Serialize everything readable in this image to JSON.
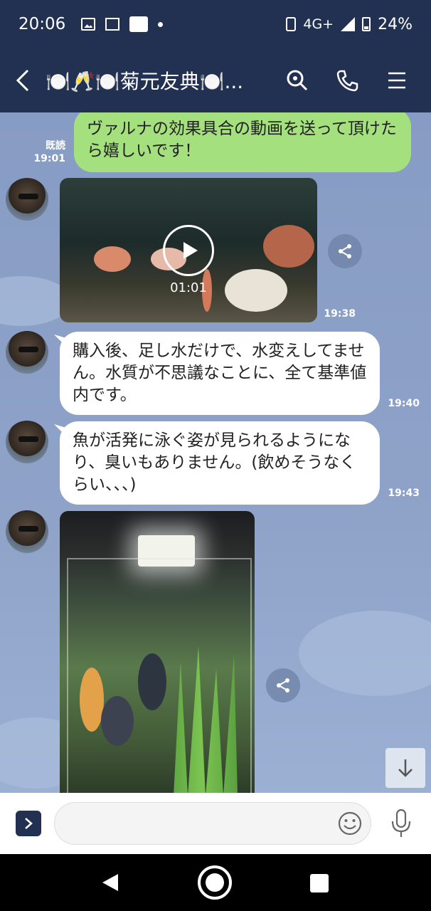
{
  "status_bar": {
    "time": "20:06",
    "network": "4G+",
    "battery": "24%",
    "icons": [
      "image-icon",
      "mail-icon",
      "app-brand-icon",
      "dot-icon",
      "vibrate-icon",
      "signal-icon",
      "battery-icon"
    ]
  },
  "header": {
    "title": "🍽️🥂🍽️菊元友典🍽️...",
    "icons": [
      "back-icon",
      "search-icon",
      "phone-icon",
      "menu-icon"
    ]
  },
  "messages": [
    {
      "type": "text",
      "direction": "outgoing",
      "text": "ヴァルナの効果具合の動画を送って頂けたら嬉しいです！",
      "read_label": "既読",
      "time": "19:01"
    },
    {
      "type": "video",
      "direction": "incoming",
      "duration": "01:01",
      "time": "19:38"
    },
    {
      "type": "text",
      "direction": "incoming",
      "text": "購入後、足し水だけで、水変えしてません。水質が不思議なことに、全て基準値内です。",
      "time": "19:40"
    },
    {
      "type": "text",
      "direction": "incoming",
      "text": "魚が活発に泳ぐ姿が見られるようになり、臭いもありません。(飲めそうなくらい、、、)",
      "time": "19:43"
    },
    {
      "type": "photo",
      "direction": "incoming"
    }
  ],
  "input": {
    "placeholder": "",
    "value": ""
  },
  "colors": {
    "header_bg": "#223152",
    "chat_bg": "#8aa0c6",
    "outgoing_bubble": "#a5e07e",
    "incoming_bubble": "#ffffff"
  }
}
